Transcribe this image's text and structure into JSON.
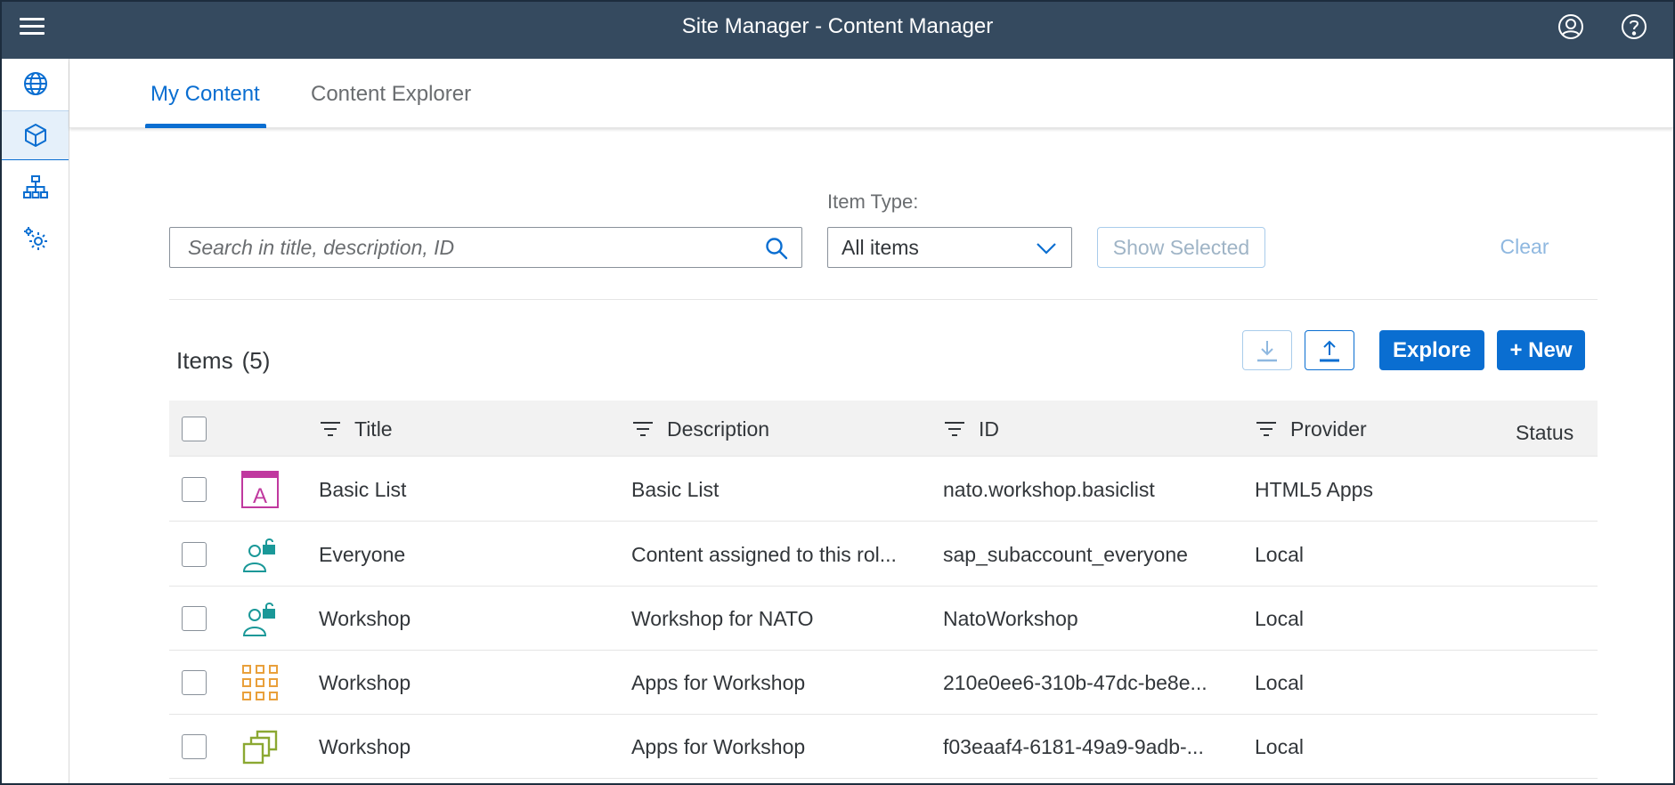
{
  "app": {
    "title": "Site Manager - Content Manager"
  },
  "shell": {
    "menu_icon": "hamburger-menu-icon",
    "user_icon": "user-account-icon",
    "help_icon": "help-icon"
  },
  "sidenav": {
    "items": [
      {
        "icon": "globe-icon",
        "selected": false
      },
      {
        "icon": "cube-icon",
        "selected": true
      },
      {
        "icon": "hierarchy-icon",
        "selected": false
      },
      {
        "icon": "settings-gears-icon",
        "selected": false
      }
    ]
  },
  "tabs": [
    {
      "label": "My Content",
      "active": true
    },
    {
      "label": "Content Explorer",
      "active": false
    }
  ],
  "filters": {
    "search_placeholder": "Search in title, description, ID",
    "search_value": "",
    "item_type_label": "Item Type:",
    "item_type_value": "All items",
    "show_selected_label": "Show Selected",
    "clear_label": "Clear"
  },
  "items": {
    "title": "Items",
    "count": "(5)",
    "explore_label": "Explore",
    "new_label": "+ New",
    "download_icon": "download-icon",
    "upload_icon": "upload-icon"
  },
  "table": {
    "columns": {
      "title": "Title",
      "description": "Description",
      "id": "ID",
      "provider": "Provider",
      "status": "Status"
    },
    "rows": [
      {
        "icon": "app-tile-icon",
        "title": "Basic List",
        "description": "Basic List",
        "id": "nato.workshop.basiclist",
        "provider": "HTML5 Apps",
        "status": ""
      },
      {
        "icon": "role-icon",
        "title": "Everyone",
        "description": "Content assigned to this rol...",
        "id": "sap_subaccount_everyone",
        "provider": "Local",
        "status": ""
      },
      {
        "icon": "role-icon",
        "title": "Workshop",
        "description": "Workshop for NATO",
        "id": "NatoWorkshop",
        "provider": "Local",
        "status": ""
      },
      {
        "icon": "catalog-grid-icon",
        "title": "Workshop",
        "description": "Apps for Workshop",
        "id": "210e0ee6-310b-47dc-be8e...",
        "provider": "Local",
        "status": ""
      },
      {
        "icon": "group-copy-icon",
        "title": "Workshop",
        "description": "Apps for Workshop",
        "id": "f03eaaf4-6181-49a9-9adb-...",
        "provider": "Local",
        "status": ""
      }
    ]
  },
  "colors": {
    "shellbar": "#354a5f",
    "accent": "#0a6ed1",
    "app_icon": "#c0399f",
    "role_icon": "#1a9898",
    "catalog_icon": "#e9a03b",
    "group_icon": "#8ba832"
  }
}
